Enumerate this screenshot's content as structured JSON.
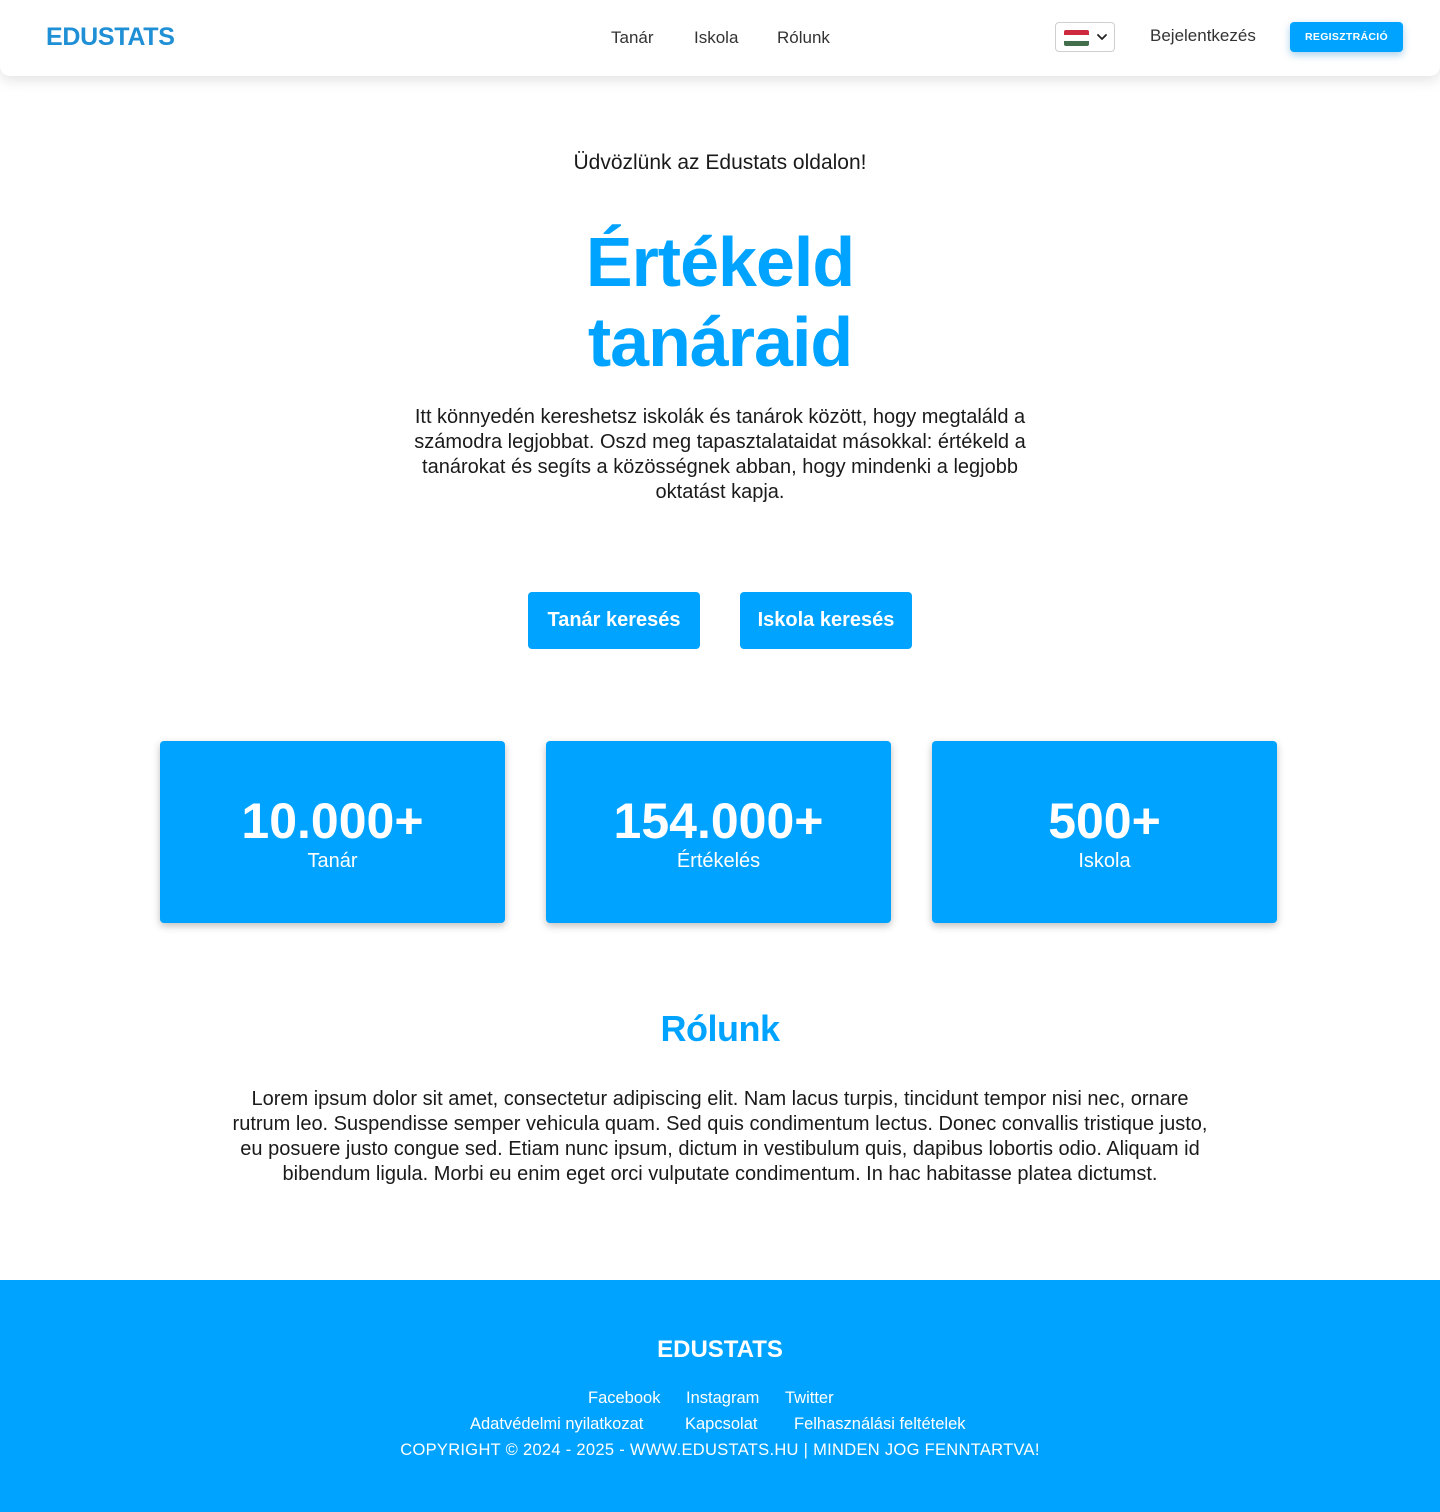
{
  "header": {
    "logo": "EDUSTATS",
    "nav": [
      "Tanár",
      "Iskola",
      "Rólunk"
    ],
    "language": "HU",
    "login_label": "Bejelentkezés",
    "register_label": "REGISZTRÁCIÓ"
  },
  "hero": {
    "welcome": "Üdvözlünk az Edustats oldalon!",
    "title_line1": "Értékeld",
    "title_line2": "tanáraid",
    "description": "Itt könnyedén kereshetsz iskolák és tanárok között, hogy megtaláld a számodra legjobbat. Oszd meg tapasztalataidat másokkal: értékeld a tanárokat és segíts a közösségnek abban, hogy mindenki a legjobb oktatást kapja.",
    "buttons": [
      "Tanár keresés",
      "Iskola keresés"
    ]
  },
  "stats": [
    {
      "value": "10.000+",
      "label": "Tanár"
    },
    {
      "value": "154.000+",
      "label": "Értékelés"
    },
    {
      "value": "500+",
      "label": "Iskola"
    }
  ],
  "about": {
    "title": "Rólunk",
    "text": "Lorem ipsum dolor sit amet, consectetur adipiscing elit. Nam lacus turpis, tincidunt tempor nisi nec, ornare rutrum leo. Suspendisse semper vehicula quam. Sed quis condimentum lectus. Donec convallis tristique justo, eu posuere justo congue sed. Etiam nunc ipsum, dictum in vestibulum quis, dapibus lobortis odio. Aliquam id bibendum ligula. Morbi eu enim eget orci vulputate condimentum. In hac habitasse platea dictumst."
  },
  "footer": {
    "logo": "EDUSTATS",
    "social": [
      "Facebook",
      "Instagram",
      "Twitter"
    ],
    "links": [
      "Adatvédelmi nyilatkozat",
      "Kapcsolat",
      "Felhasználási feltételek"
    ],
    "copyright": "COPYRIGHT © 2024 - 2025 - WWW.EDUSTATS.HU | MINDEN JOG FENNTARTVA!"
  },
  "colors": {
    "accent": "#00a3ff",
    "logo": "#1f8fd6",
    "flag": [
      "#cd2a3e",
      "#ffffff",
      "#436f4d"
    ]
  },
  "icons": {
    "language": "hungary-flag-icon",
    "dropdown": "chevron-down-icon"
  }
}
